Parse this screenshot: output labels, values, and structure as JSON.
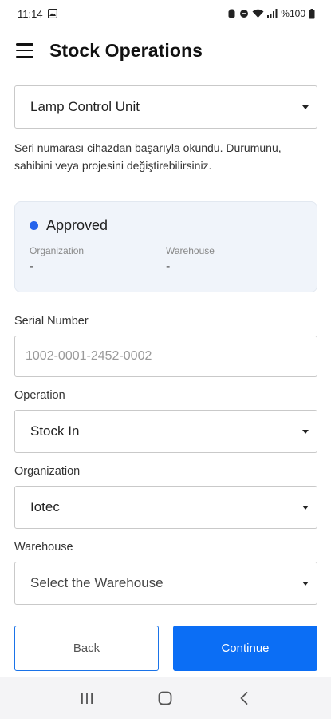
{
  "status_bar": {
    "time": "11:14",
    "battery": "%100"
  },
  "app_bar": {
    "title": "Stock Operations"
  },
  "device_select": {
    "value": "Lamp Control Unit"
  },
  "info_text": "Seri numarası cihazdan başarıyla okundu. Durumunu, sahibini veya projesini değiştirebilirsiniz.",
  "status_card": {
    "status": "Approved",
    "status_color": "#2563eb",
    "organization_label": "Organization",
    "organization_value": "-",
    "warehouse_label": "Warehouse",
    "warehouse_value": "-"
  },
  "form": {
    "serial_label": "Serial Number",
    "serial_placeholder": "1002-0001-2452-0002",
    "operation_label": "Operation",
    "operation_value": "Stock In",
    "organization_label": "Organization",
    "organization_value": "Iotec",
    "warehouse_label": "Warehouse",
    "warehouse_value": "Select the Warehouse"
  },
  "buttons": {
    "back": "Back",
    "continue": "Continue"
  },
  "colors": {
    "primary": "#0b6ef5",
    "card_bg": "#f0f4fa"
  }
}
